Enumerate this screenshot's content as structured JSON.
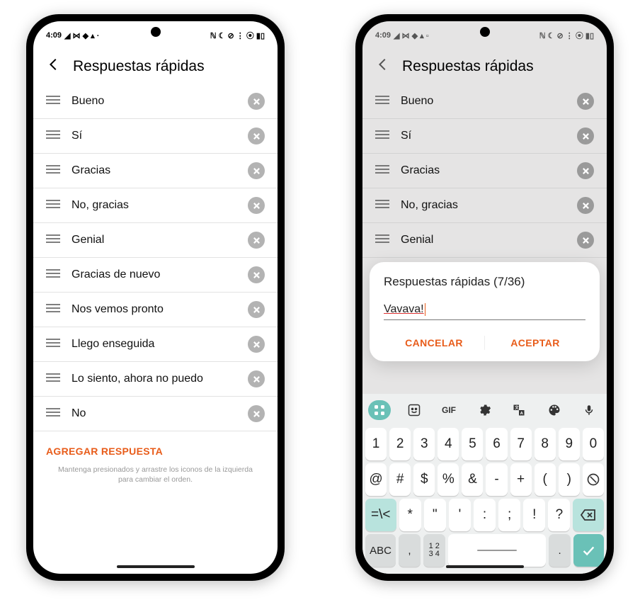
{
  "status": {
    "time": "4:09"
  },
  "header": {
    "title": "Respuestas rápidas"
  },
  "replies": [
    "Bueno",
    "Sí",
    "Gracias",
    "No, gracias",
    "Genial",
    "Gracias de nuevo",
    "Nos vemos pronto",
    "Llego enseguida",
    "Lo siento, ahora no puedo",
    "No"
  ],
  "add_label": "AGREGAR RESPUESTA",
  "hint": "Mantenga presionados y arrastre los iconos de la izquierda para cambiar el orden.",
  "dialog": {
    "title": "Respuestas rápidas (7/36)",
    "value": "Vavava!",
    "cancel": "CANCELAR",
    "accept": "ACEPTAR"
  },
  "keyboard": {
    "row1": [
      "1",
      "2",
      "3",
      "4",
      "5",
      "6",
      "7",
      "8",
      "9",
      "0"
    ],
    "row2": [
      "@",
      "#",
      "$",
      "%",
      "&",
      "-",
      "+",
      "(",
      ")"
    ],
    "row3_lead": "=\\<",
    "row3": [
      "*",
      "\"",
      "'",
      ":",
      ";",
      "!",
      "?"
    ],
    "row4_abc": "ABC",
    "row4_commas": ",",
    "row4_nums": "1 2\n3 4",
    "row4_dot": "."
  }
}
